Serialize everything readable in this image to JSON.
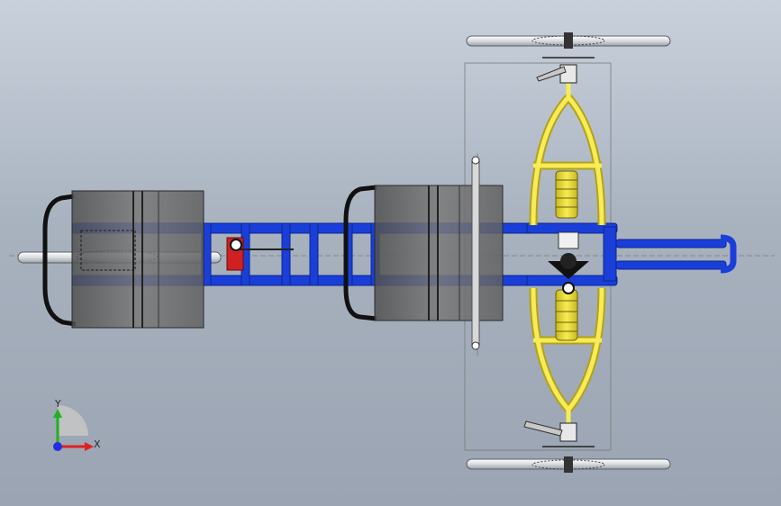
{
  "app": {
    "type": "CAD model viewport",
    "view": "top"
  },
  "triad": {
    "x_label": "X",
    "y_label": "Y",
    "x_color": "#e02020",
    "y_color": "#20b020",
    "z_color": "#2030e0"
  },
  "colors": {
    "background_top": "#c9d1dc",
    "background_bottom": "#9aa4b2",
    "frame_blue": "#1a3fd8",
    "suspension_yellow": "#f2e23a",
    "seat_grey": "#6a6a6a",
    "wheel_light": "#e9ecef",
    "accent_red": "#d02020"
  },
  "icons": {
    "triad": "coordinate-axes-icon"
  }
}
